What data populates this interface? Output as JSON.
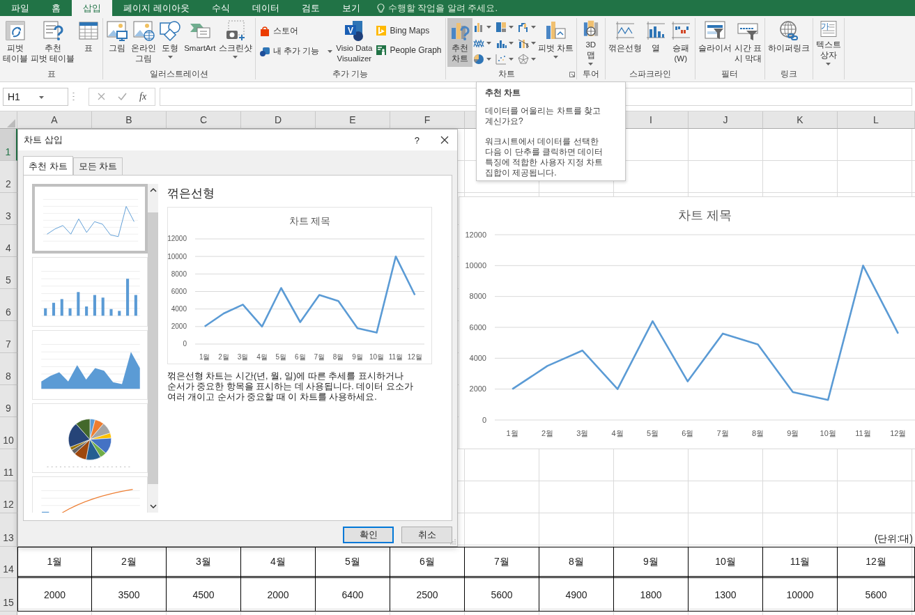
{
  "ribbon_tabs": [
    {
      "label": "파일",
      "selected": false
    },
    {
      "label": "홈",
      "selected": false
    },
    {
      "label": "삽입",
      "selected": true
    },
    {
      "label": "페이지 레이아웃",
      "selected": false
    },
    {
      "label": "수식",
      "selected": false
    },
    {
      "label": "데이터",
      "selected": false
    },
    {
      "label": "검토",
      "selected": false
    },
    {
      "label": "보기",
      "selected": false
    }
  ],
  "tell_me": {
    "placeholder": "수행할 작업을 알려 주세요."
  },
  "ribbon_groups": [
    {
      "label": "표",
      "buttons": [
        {
          "kind": "large",
          "label": "피벗\n테이블",
          "dropdown": false,
          "highlighted": false
        },
        {
          "kind": "large",
          "label": "추천\n피벗 테이블",
          "dropdown": false,
          "highlighted": false
        },
        {
          "kind": "large",
          "label": "표",
          "dropdown": false,
          "highlighted": false
        }
      ]
    },
    {
      "label": "일러스트레이션",
      "buttons": [
        {
          "kind": "large",
          "label": "그림",
          "dropdown": false,
          "highlighted": false
        },
        {
          "kind": "large",
          "label": "온라인\n그림",
          "dropdown": false,
          "highlighted": false
        },
        {
          "kind": "large",
          "label": "도형",
          "dropdown": true,
          "highlighted": false
        },
        {
          "kind": "large",
          "label": "SmartArt",
          "dropdown": false,
          "highlighted": false
        },
        {
          "kind": "large",
          "label": "스크린샷",
          "dropdown": true,
          "highlighted": false
        }
      ]
    },
    {
      "label": "추가 기능",
      "buttons": [
        {
          "kind": "small",
          "label": "스토어",
          "dropdown": false,
          "highlighted": false
        },
        {
          "kind": "small",
          "label": "내 추가 기능",
          "dropdown": true,
          "highlighted": false
        },
        {
          "kind": "large",
          "label": "Visio Data\nVisualizer",
          "icon_text": "V",
          "dropdown": false,
          "highlighted": false
        },
        {
          "kind": "small",
          "label": "Bing Maps",
          "dropdown": false,
          "highlighted": false
        },
        {
          "kind": "small",
          "label": "People Graph",
          "dropdown": false,
          "highlighted": false
        }
      ]
    },
    {
      "label": "차트",
      "launcher": true,
      "buttons": [
        {
          "kind": "large",
          "label": "추천\n차트",
          "dropdown": false,
          "highlighted": true
        },
        {
          "kind": "gallery"
        },
        {
          "kind": "large",
          "label": "피벗 차트",
          "dropdown": true,
          "highlighted": false
        }
      ]
    },
    {
      "label": "투어",
      "buttons": [
        {
          "kind": "large",
          "label": "3D\n맵",
          "dropdown": true,
          "highlighted": false
        }
      ]
    },
    {
      "label": "스파크라인",
      "buttons": [
        {
          "kind": "large",
          "label": "꺾은선형",
          "dropdown": false,
          "highlighted": false
        },
        {
          "kind": "large",
          "label": "열",
          "dropdown": false,
          "highlighted": false
        },
        {
          "kind": "large",
          "label": "승패\n(W)",
          "dropdown": false,
          "highlighted": false
        }
      ]
    },
    {
      "label": "필터",
      "buttons": [
        {
          "kind": "large",
          "label": "슬라이서",
          "dropdown": false,
          "highlighted": false
        },
        {
          "kind": "large",
          "label": "시간 표\n시 막대",
          "dropdown": false,
          "highlighted": false
        }
      ]
    },
    {
      "label": "링크",
      "buttons": [
        {
          "kind": "large",
          "label": "하이퍼링크",
          "dropdown": false,
          "highlighted": false
        }
      ]
    },
    {
      "buttons": [
        {
          "kind": "large",
          "label": "텍스트\n상자",
          "icon_text": "가",
          "dropdown": true,
          "highlighted": false
        }
      ]
    }
  ],
  "formula_bar": {
    "name_box": "H1",
    "function_label": "fx"
  },
  "columns": [
    {
      "label": "A"
    },
    {
      "label": "B"
    },
    {
      "label": "C"
    },
    {
      "label": "D"
    },
    {
      "label": "E"
    },
    {
      "label": "F"
    },
    {},
    {},
    {
      "label": "I"
    },
    {
      "label": "J"
    },
    {
      "label": "K"
    },
    {
      "label": "L"
    }
  ],
  "rows": [
    {
      "label": "1",
      "selected": true
    },
    {
      "label": "2",
      "selected": false
    },
    {
      "label": "3",
      "selected": false
    },
    {
      "label": "4",
      "selected": false
    },
    {
      "label": "5",
      "selected": false
    },
    {
      "label": "6",
      "selected": false
    },
    {
      "label": "7",
      "selected": false
    },
    {
      "label": "8",
      "selected": false
    },
    {
      "label": "9",
      "selected": false
    },
    {
      "label": "10",
      "selected": false
    },
    {
      "label": "11",
      "selected": false
    },
    {
      "label": "12",
      "selected": false
    },
    {
      "label": "13",
      "selected": false
    },
    {
      "label": "14",
      "selected": false
    },
    {
      "label": "15",
      "selected": false
    }
  ],
  "table": {
    "note": "(단위:대)",
    "months": [
      "1월",
      "2월",
      "3월",
      "4월",
      "5월",
      "6월",
      "7월",
      "8월",
      "9월",
      "10월",
      "11월",
      "12월"
    ],
    "values": [
      "2000",
      "3500",
      "4500",
      "2000",
      "6400",
      "2500",
      "5600",
      "4900",
      "1800",
      "1300",
      "10000",
      "5600"
    ]
  },
  "dialog": {
    "title": "차트 삽입",
    "help": "?",
    "tabs": [
      {
        "label": "추천 차트",
        "selected": true
      },
      {
        "label": "모든 차트",
        "selected": false
      }
    ],
    "thumbnails": [
      {
        "kind": "line",
        "selected": true
      },
      {
        "kind": "column",
        "selected": false
      },
      {
        "kind": "area",
        "selected": false
      },
      {
        "kind": "pie",
        "selected": false
      },
      {
        "kind": "combo",
        "selected": false
      }
    ],
    "chart_name": "꺾은선형",
    "preview": {
      "chart_data": {
        "type": "line",
        "title": "차트 제목",
        "categories": [
          "1월",
          "2월",
          "3월",
          "4월",
          "5월",
          "6월",
          "7월",
          "8월",
          "9월",
          "10월",
          "11월",
          "12월"
        ],
        "series": [
          {
            "color": "#5b9bd5",
            "values": [
              2000,
              3500,
              4500,
              2000,
              6400,
              2500,
              5600,
              4900,
              1800,
              1300,
              10000,
              5600
            ]
          }
        ],
        "ylim": [
          0,
          12000
        ],
        "yticks": [
          0,
          2000,
          4000,
          6000,
          8000,
          10000,
          12000
        ],
        "grid": true
      }
    },
    "description": "꺾은선형 차트는 시간(년, 월, 일)에 따른 추세를 표시하거나 순서가 중요한 항목을 표시하는 데 사용됩니다. 데이터 요소가 여러 개이고 순서가 중요할 때 이 차트를 사용하세요.",
    "buttons": [
      {
        "label": "확인",
        "default": true
      },
      {
        "label": "취소",
        "default": false
      }
    ]
  },
  "tooltip": {
    "title": "추천 차트",
    "paragraphs": [
      "데이터를 어울리는 차트를 찾고 계신가요?",
      "워크시트에서 데이터를 선택한 다음 이 단추를 클릭하면 데이터 특징에 적합한 사용자 지정 차트 집합이 제공됩니다."
    ]
  },
  "sheet_chart": {
    "chart_data": {
      "type": "line",
      "title": "차트 제목",
      "categories": [
        "1월",
        "2월",
        "3월",
        "4월",
        "5월",
        "6월",
        "7월",
        "8월",
        "9월",
        "10월",
        "11월",
        "12월"
      ],
      "series": [
        {
          "color": "#5b9bd5",
          "values": [
            2000,
            3500,
            4500,
            2000,
            6400,
            2500,
            5600,
            4900,
            1800,
            1300,
            10000,
            5600
          ]
        }
      ],
      "ylim": [
        0,
        12000
      ],
      "yticks": [
        0,
        2000,
        4000,
        6000,
        8000,
        10000,
        12000
      ],
      "grid": true
    }
  }
}
